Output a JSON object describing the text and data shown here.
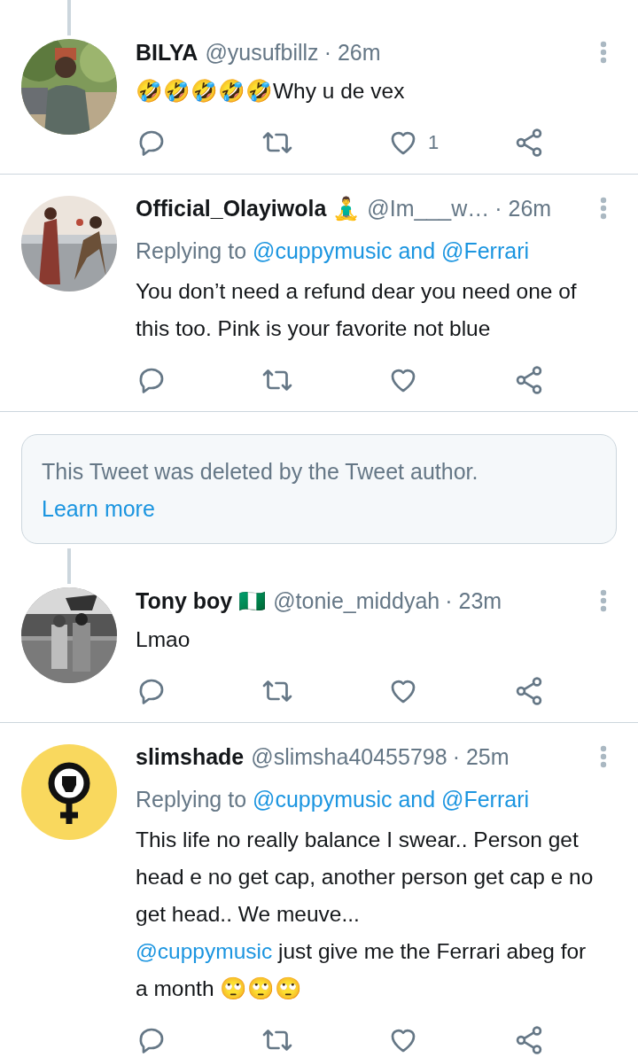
{
  "timeline": [
    {
      "kind": "tweet",
      "thread_above": true,
      "name": "BILYA",
      "handle": "@yusufbillz",
      "time": "· 26m",
      "body": [
        {
          "kind": "text",
          "text": "🤣🤣🤣🤣🤣Why u de vex"
        }
      ],
      "like_count": "1"
    },
    {
      "kind": "tweet",
      "thread_above": false,
      "name": "Official_Olayiwola 🧘‍♂️",
      "handle": "@Im___w…",
      "time": "· 26m",
      "replying_to": {
        "label": "Replying to",
        "mentions": "@cuppymusic and @Ferrari"
      },
      "body": [
        {
          "kind": "text",
          "text": "You don’t need a refund dear you need one of this too. Pink is your favorite not blue"
        }
      ]
    },
    {
      "kind": "deleted",
      "text": "This Tweet was deleted by the Tweet author.",
      "link": "Learn more"
    },
    {
      "kind": "tweet",
      "thread_above": true,
      "name": "Tony boy 🇳🇬",
      "handle": "@tonie_middyah",
      "time": "· 23m",
      "body": [
        {
          "kind": "text",
          "text": "Lmao"
        }
      ]
    },
    {
      "kind": "tweet",
      "thread_above": false,
      "avatar": {
        "kind": "symbol"
      },
      "name": "slimshade",
      "handle": "@slimsha40455798",
      "time": "· 25m",
      "replying_to": {
        "label": "Replying to",
        "mentions": "@cuppymusic and @Ferrari"
      },
      "body": [
        {
          "kind": "text",
          "text": "This life no really balance I swear.. Person get head e no get cap, another person get cap e no get head.. We meuve...\n"
        },
        {
          "kind": "mention",
          "text": "@cuppymusic"
        },
        {
          "kind": "text",
          "text": " just give me the Ferrari abeg for a month 🙄🙄🙄"
        }
      ]
    }
  ]
}
